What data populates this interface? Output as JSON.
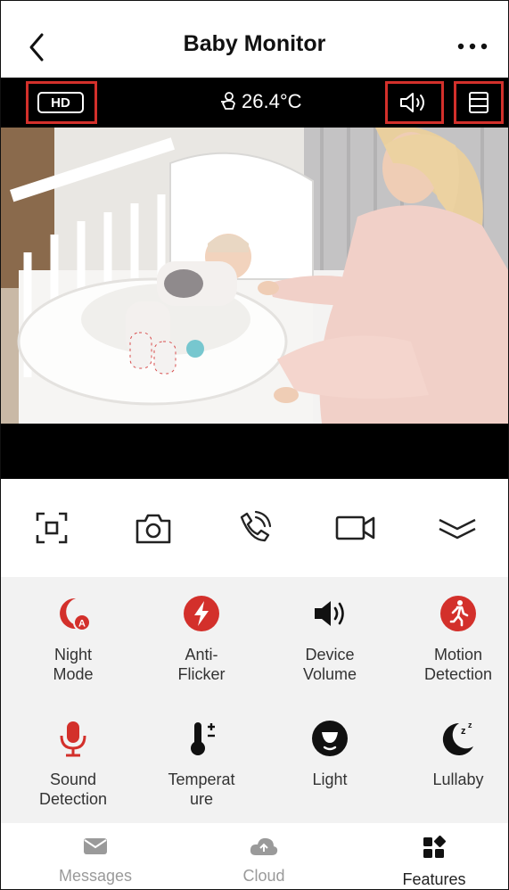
{
  "header": {
    "title": "Baby Monitor"
  },
  "status": {
    "quality": "HD",
    "temperature": "26.4°C"
  },
  "toolbar": {
    "items": [
      "fullscreen-icon",
      "camera-icon",
      "phone-call-icon",
      "video-record-icon",
      "collapse-icon"
    ]
  },
  "features": [
    {
      "label": "Night Mode",
      "icon": "night-mode-icon"
    },
    {
      "label": "Anti- Flicker",
      "icon": "anti-flicker-icon"
    },
    {
      "label": "Device Volume",
      "icon": "device-volume-icon"
    },
    {
      "label": "Motion Detection",
      "icon": "motion-detection-icon"
    },
    {
      "label": "Sound Detection",
      "icon": "sound-detection-icon"
    },
    {
      "label": "Temperat ure",
      "icon": "temperature-icon"
    },
    {
      "label": "Light",
      "icon": "light-icon"
    },
    {
      "label": "Lullaby",
      "icon": "lullaby-icon"
    }
  ],
  "features_lines": {
    "f0a": "Night",
    "f0b": "Mode",
    "f1a": "Anti-",
    "f1b": "Flicker",
    "f2a": "Device",
    "f2b": "Volume",
    "f3a": "Motion",
    "f3b": "Detection",
    "f4a": "Sound",
    "f4b": "Detection",
    "f5a": "Temperat",
    "f5b": "ure",
    "f6a": "Light",
    "f7a": "Lullaby"
  },
  "nav": {
    "messages": "Messages",
    "cloud": "Cloud",
    "features": "Features"
  },
  "colors": {
    "accent": "#d3302b",
    "dark": "#111111",
    "muted": "#9a9a9a"
  }
}
